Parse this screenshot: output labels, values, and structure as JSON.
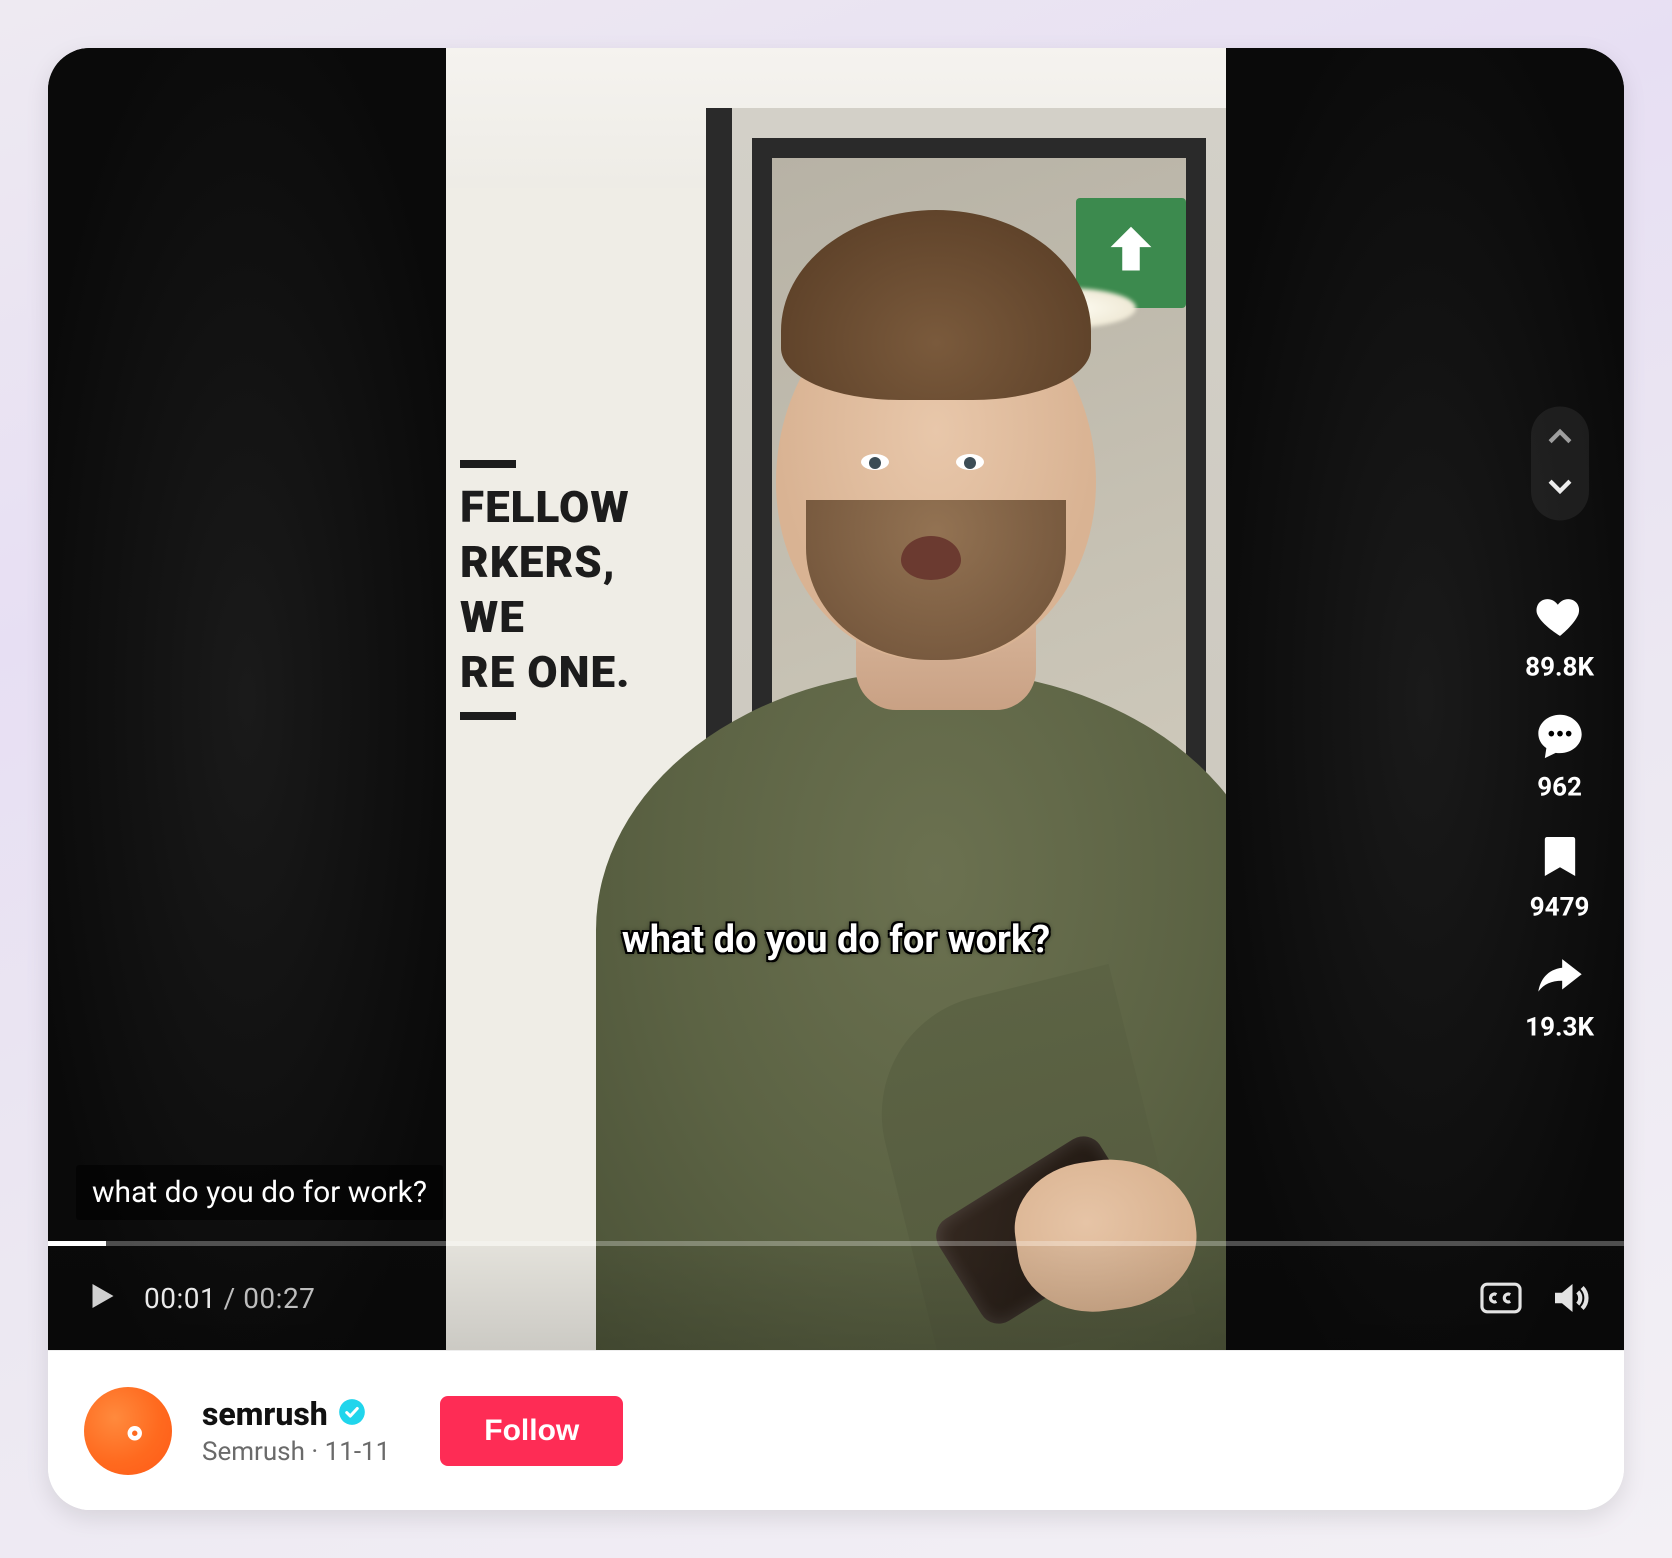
{
  "video": {
    "center_caption": "what do you do for work?",
    "bottom_caption": "what do you do for work?",
    "wall_text_line1": "FELLOW",
    "wall_text_line2": "RKERS, WE",
    "wall_text_line3": "RE ONE.",
    "time_current": "00:01",
    "time_separator": " / ",
    "time_total": "00:27",
    "duration_seconds": 27,
    "elapsed_seconds": 1
  },
  "engagement": {
    "likes": "89.8K",
    "comments": "962",
    "bookmarks": "9479",
    "shares": "19.3K"
  },
  "poster": {
    "username": "semrush",
    "display_name": "Semrush",
    "date": "11-11",
    "verified": true,
    "follow_label": "Follow"
  },
  "colors": {
    "brand_accent": "#fe2c55",
    "avatar_bg": "#ff6a1f",
    "verified_badge": "#20d5ec"
  }
}
